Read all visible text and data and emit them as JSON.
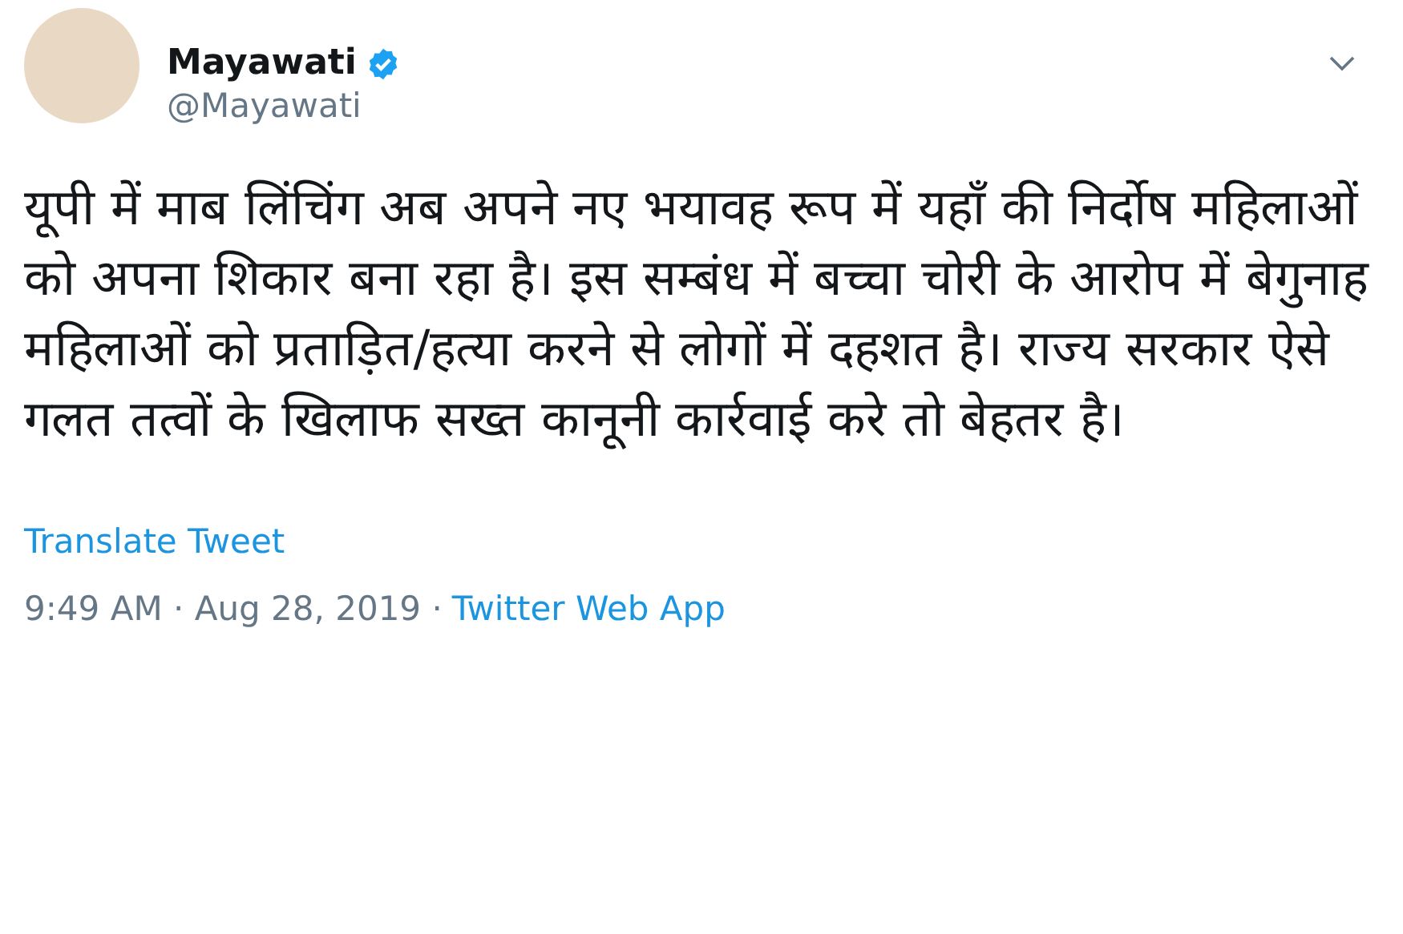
{
  "author": {
    "name": "Mayawati",
    "handle": "@Mayawati",
    "verified": true
  },
  "tweet": {
    "text": "यूपी में माब लिंचिंग अब अपने नए भयावह रूप में यहाँ की निर्दोष महिलाओं को अपना शिकार बना रहा है। इस सम्बंध में बच्चा चोरी के आरोप में बेगुनाह महिलाओं को प्रताड़ित/हत्या करने से लोगों में दहशत है। राज्य सरकार ऐसे गलत तत्वों के खिलाफ सख्त कानूनी कार्रवाई करे तो बेहतर है।"
  },
  "translate_link": "Translate Tweet",
  "timestamp": "9:49 AM · Aug 28, 2019 ·",
  "source_link": "Twitter Web App"
}
